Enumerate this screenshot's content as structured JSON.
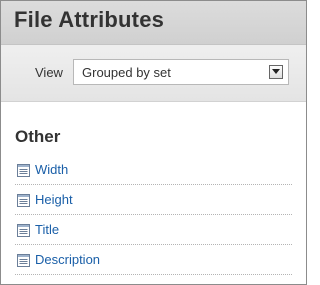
{
  "header": {
    "title": "File Attributes",
    "view_label": "View",
    "view_select": {
      "selected": "Grouped by set"
    }
  },
  "section": {
    "title": "Other",
    "items": [
      {
        "label": "Width",
        "icon": "document-icon"
      },
      {
        "label": "Height",
        "icon": "document-icon"
      },
      {
        "label": "Title",
        "icon": "document-icon"
      },
      {
        "label": "Description",
        "icon": "document-icon"
      }
    ]
  },
  "colors": {
    "link": "#1a5fa8",
    "text": "#333333",
    "header_band": "#d0d0d0"
  }
}
